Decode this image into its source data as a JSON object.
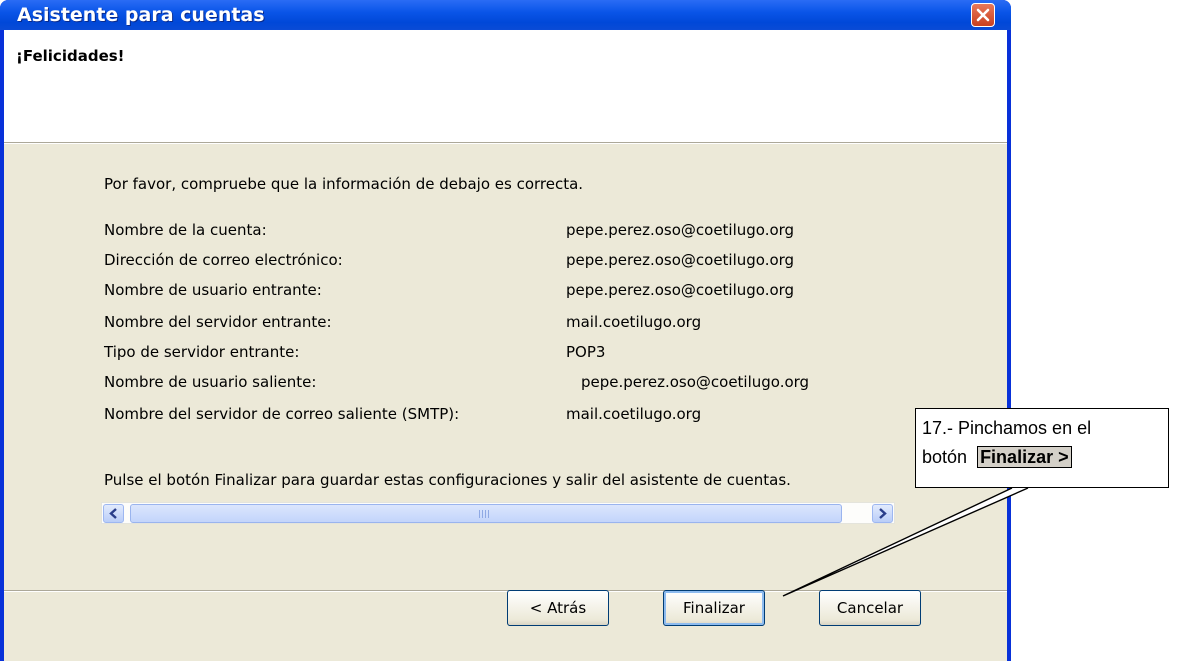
{
  "window": {
    "title": "Asistente para cuentas"
  },
  "header": {
    "title": "¡Felicidades!"
  },
  "content": {
    "intro": "Por favor, compruebe que la información de debajo es correcta.",
    "info": [
      {
        "label": "Nombre de la cuenta:",
        "value": "pepe.perez.oso@coetilugo.org"
      },
      {
        "label": "Dirección de correo electrónico:",
        "value": "pepe.perez.oso@coetilugo.org"
      },
      {
        "label": "Nombre de usuario entrante:",
        "value": "pepe.perez.oso@coetilugo.org"
      },
      {
        "label": "Nombre del servidor entrante:",
        "value": "mail.coetilugo.org"
      },
      {
        "label": "Tipo de servidor entrante:",
        "value": "POP3"
      },
      {
        "label": "Nombre de usuario saliente:",
        "value": "pepe.perez.oso@coetilugo.org"
      },
      {
        "label": "Nombre del servidor de correo saliente (SMTP):",
        "value": "mail.coetilugo.org"
      }
    ],
    "footer": "Pulse el botón Finalizar para guardar estas configuraciones y salir del asistente de cuentas."
  },
  "buttons": {
    "back": "< Atrás",
    "finish": "Finalizar",
    "cancel": "Cancelar"
  },
  "callout": {
    "line1": "17.- Pinchamos en el",
    "line2_prefix": "botón",
    "line2_button": "Finalizar >"
  },
  "icons": {
    "close": "close-icon",
    "scroll_left": "arrow-left-icon",
    "scroll_right": "arrow-right-icon"
  },
  "colors": {
    "titlebar": "#0a55e8",
    "dialog_bg": "#ece9d8",
    "close_button": "#d9502c"
  }
}
